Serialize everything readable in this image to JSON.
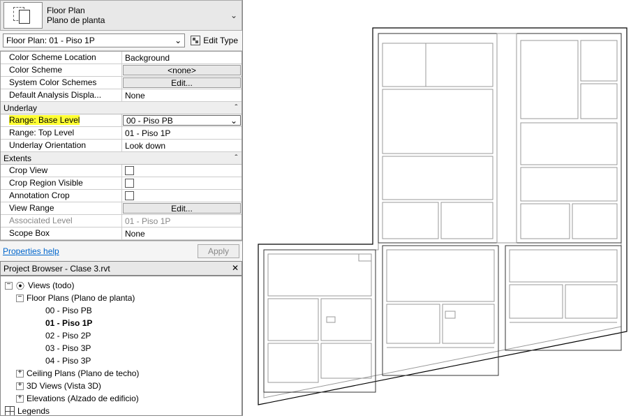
{
  "header": {
    "title": "Floor Plan",
    "subtitle": "Plano de planta"
  },
  "selector": {
    "value": "Floor Plan: 01 - Piso 1P",
    "edit_type": "Edit Type"
  },
  "props": {
    "color_scheme_location": {
      "label": "Color Scheme Location",
      "value": "Background"
    },
    "color_scheme": {
      "label": "Color Scheme",
      "value": "<none>"
    },
    "system_color_schemes": {
      "label": "System Color Schemes",
      "value": "Edit..."
    },
    "default_analysis": {
      "label": "Default Analysis Displa...",
      "value": "None"
    },
    "underlay": {
      "label": "Underlay"
    },
    "range_base": {
      "prefix": "Range: ",
      "highlight": "Base Level",
      "value": "00 - Piso PB"
    },
    "range_top": {
      "label": "Range: Top Level",
      "value": "01 - Piso 1P"
    },
    "underlay_orient": {
      "label": "Underlay Orientation",
      "value": "Look down"
    },
    "extents": {
      "label": "Extents"
    },
    "crop_view": {
      "label": "Crop View"
    },
    "crop_region": {
      "label": "Crop Region Visible"
    },
    "annotation_crop": {
      "label": "Annotation Crop"
    },
    "view_range": {
      "label": "View Range",
      "value": "Edit..."
    },
    "assoc_level": {
      "label": "Associated Level",
      "value": "01 - Piso 1P"
    },
    "scope_box": {
      "label": "Scope Box",
      "value": "None"
    }
  },
  "footer": {
    "help": "Properties help",
    "apply": "Apply"
  },
  "browser": {
    "title": "Project Browser - Clase 3.rvt"
  },
  "tree": {
    "views": "Views (todo)",
    "floor_plans": "Floor Plans (Plano de planta)",
    "p00": "00 - Piso PB",
    "p01": "01 - Piso 1P",
    "p02": "02 - Piso 2P",
    "p03": "03 - Piso 3P",
    "p04": "04 - Piso 3P",
    "ceiling": "Ceiling Plans (Plano de techo)",
    "views3d": "3D Views (Vista 3D)",
    "elevations": "Elevations (Alzado de edificio)",
    "legends": "Legends"
  },
  "chev": "⌄",
  "collapse": "ˆ"
}
